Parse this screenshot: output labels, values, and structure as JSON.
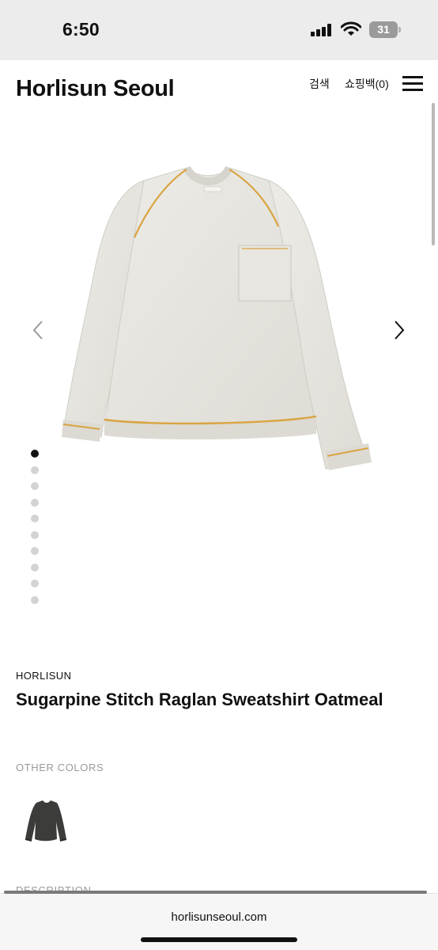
{
  "status_bar": {
    "time": "6:50",
    "battery_level": "31",
    "icons": [
      "signal-icon",
      "wifi-icon",
      "battery-icon"
    ]
  },
  "header": {
    "logo": "Horlisun Seoul",
    "search_label": "검색",
    "cart_label": "쇼핑백(0)",
    "menu_icon": "hamburger-menu-icon"
  },
  "gallery": {
    "image_count": 10,
    "active_index": 0,
    "prev_icon": "chevron-left-icon",
    "next_icon": "chevron-right-icon"
  },
  "product": {
    "brand": "HORLISUN",
    "title": "Sugarpine Stitch Raglan Sweatshirt Oatmeal",
    "other_colors_label": "OTHER COLORS",
    "description_label": "DESCRIPTION"
  },
  "browser": {
    "url": "horlisunseoul.com"
  },
  "colors": {
    "status_bar_bg": "#ececec",
    "sweatshirt": "#e6e4de",
    "piping": "#d9a441",
    "swatch": "#3c3c3a",
    "muted_text": "#9a9a9a"
  }
}
